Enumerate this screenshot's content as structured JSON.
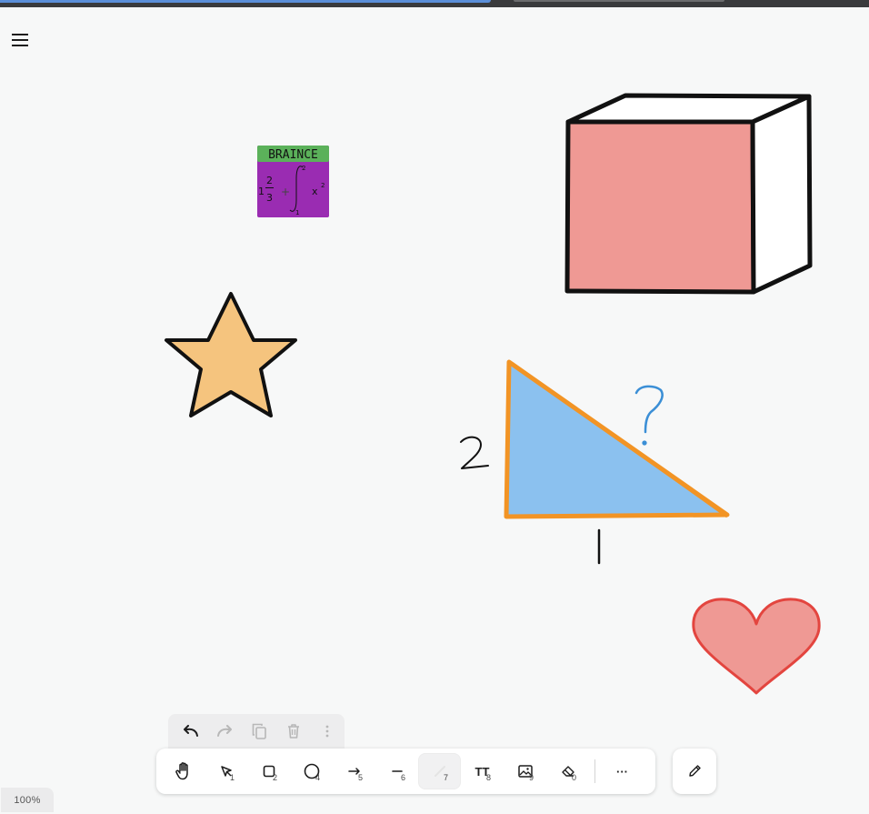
{
  "app": {
    "zoom_level": "100%"
  },
  "icons": {
    "menu": "hamburger-menu-icon",
    "undo": "undo-icon",
    "redo": "redo-icon",
    "duplicate": "duplicate-icon",
    "delete": "trash-icon",
    "more_actions": "more-vertical-icon",
    "pencil": "pencil-icon"
  },
  "canvas": {
    "sticker": {
      "header_text": "BRAINCE",
      "header_color": "#5bb15a",
      "body_color": "#9a2cb2",
      "formula": {
        "whole": "1",
        "numerator": "2",
        "denominator": "3",
        "plus": "+",
        "integral_upper": "2",
        "integral_lower": "1",
        "base": "x",
        "exponent": "2"
      }
    },
    "shapes": {
      "cube_front_fill": "#ef9994",
      "star_fill": "#f5c47e",
      "triangle_fill": "#8bc1ef",
      "triangle_stroke": "#f29425",
      "heart_fill": "#ef9994",
      "heart_stroke": "#e3453f",
      "question_color": "#3b8fd6"
    }
  },
  "tools": [
    {
      "name": "hand",
      "icon": "hand-icon",
      "shortcut": ""
    },
    {
      "name": "select",
      "icon": "select-cursor-icon",
      "shortcut": "1"
    },
    {
      "name": "rectangle",
      "icon": "rectangle-icon",
      "shortcut": "2"
    },
    {
      "name": "ellipse",
      "icon": "ellipse-icon",
      "shortcut": "4"
    },
    {
      "name": "arrow",
      "icon": "arrow-icon",
      "shortcut": "5"
    },
    {
      "name": "line",
      "icon": "line-icon",
      "shortcut": "6"
    },
    {
      "name": "draw",
      "icon": "draw-icon",
      "shortcut": "7",
      "active": true
    },
    {
      "name": "text",
      "icon": "text-icon",
      "label": "TT",
      "shortcut": "8"
    },
    {
      "name": "image",
      "icon": "image-icon",
      "shortcut": "9"
    },
    {
      "name": "eraser",
      "icon": "eraser-icon",
      "shortcut": "0"
    },
    {
      "name": "more",
      "icon": "more-horizontal-icon",
      "label": "···"
    }
  ]
}
